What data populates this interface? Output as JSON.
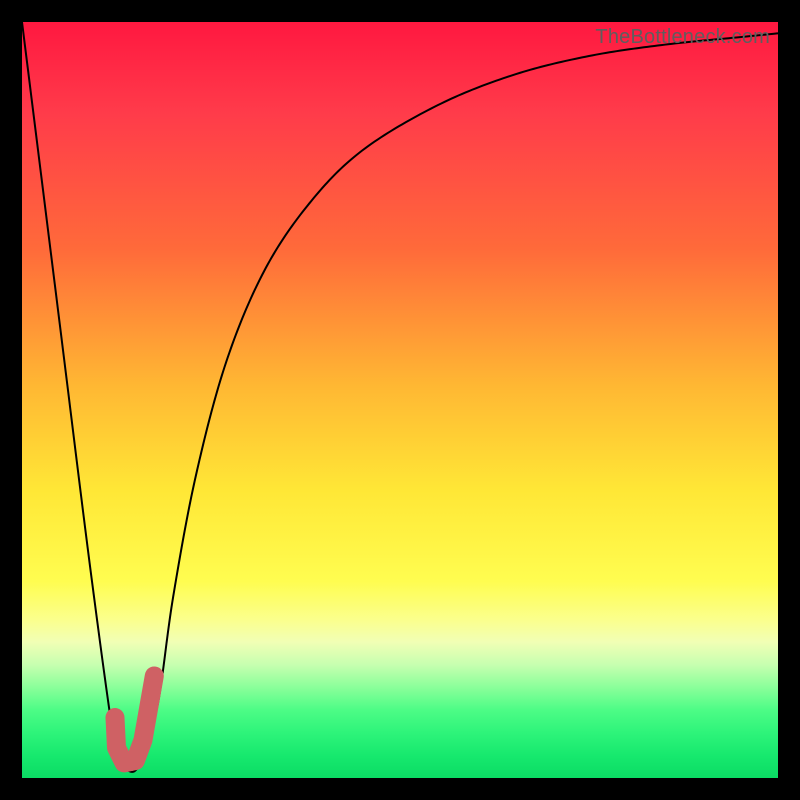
{
  "watermark": "TheBottleneck.com",
  "colors": {
    "frame": "#000000",
    "curve": "#000000",
    "mark": "#cf6164",
    "gradient_top": "#ff1840",
    "gradient_bottom": "#0bdc64"
  },
  "chart_data": {
    "type": "line",
    "title": "",
    "xlabel": "",
    "ylabel": "",
    "xlim": [
      0,
      100
    ],
    "ylim": [
      0,
      100
    ],
    "grid": false,
    "legend": false,
    "series": [
      {
        "name": "bottleneck-curve",
        "x": [
          0,
          5,
          9,
          12,
          13,
          14,
          15,
          16,
          18,
          20,
          23,
          27,
          32,
          38,
          45,
          55,
          65,
          75,
          85,
          95,
          100
        ],
        "values": [
          100,
          60,
          28,
          6,
          2,
          1,
          1,
          3,
          10,
          24,
          40,
          55,
          67,
          76,
          83,
          89,
          93,
          95.5,
          97,
          98,
          98.5
        ]
      }
    ],
    "annotations": [
      {
        "name": "j-mark",
        "description": "Thick pink J-shaped mark near the curve minimum",
        "path_xy": [
          [
            12.3,
            8.0
          ],
          [
            12.5,
            4.0
          ],
          [
            13.5,
            2.0
          ],
          [
            15.0,
            2.3
          ],
          [
            16.0,
            5.0
          ],
          [
            17.5,
            13.5
          ]
        ]
      }
    ]
  }
}
